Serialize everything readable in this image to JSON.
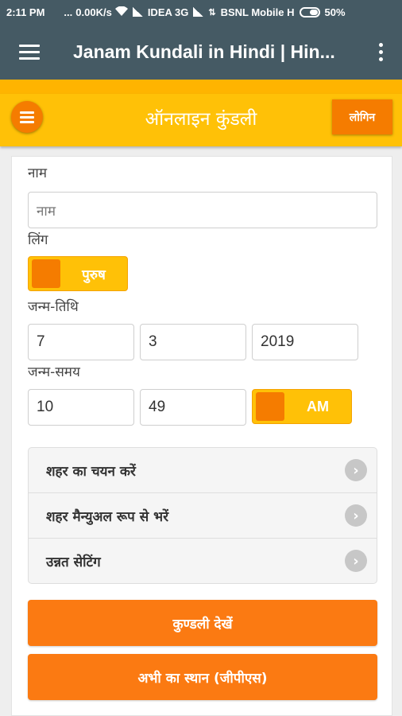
{
  "status_bar": {
    "time": "2:11 PM",
    "dots": "...",
    "speed": "0.00K/s",
    "carrier1": "IDEA 3G",
    "carrier2": "BSNL Mobile H",
    "battery": "50%"
  },
  "app_bar": {
    "title": "Janam Kundali in Hindi | Hin..."
  },
  "header": {
    "title": "ऑनलाइन कुंडली",
    "login_label": "लोगिन"
  },
  "form": {
    "name_label": "नाम",
    "name_placeholder": "नाम",
    "gender_label": "लिंग",
    "gender_value": "पुरुष",
    "dob_label": "जन्म-तिथि",
    "dob_day": "7",
    "dob_month": "3",
    "dob_year": "2019",
    "tob_label": "जन्म-समय",
    "tob_hour": "10",
    "tob_minute": "49",
    "ampm": "AM"
  },
  "options": [
    {
      "label": "शहर का चयन करें"
    },
    {
      "label": "शहर मैन्युअल रूप से भरें"
    },
    {
      "label": "उन्नत सेटिंग"
    }
  ],
  "buttons": {
    "view_kundali": "कुण्डली देखें",
    "current_location": "अभी का स्थान (जीपीएस)"
  },
  "colors": {
    "appbar": "#455a64",
    "header": "#ffc107",
    "accent": "#f57c00",
    "button": "#fb7a12"
  }
}
